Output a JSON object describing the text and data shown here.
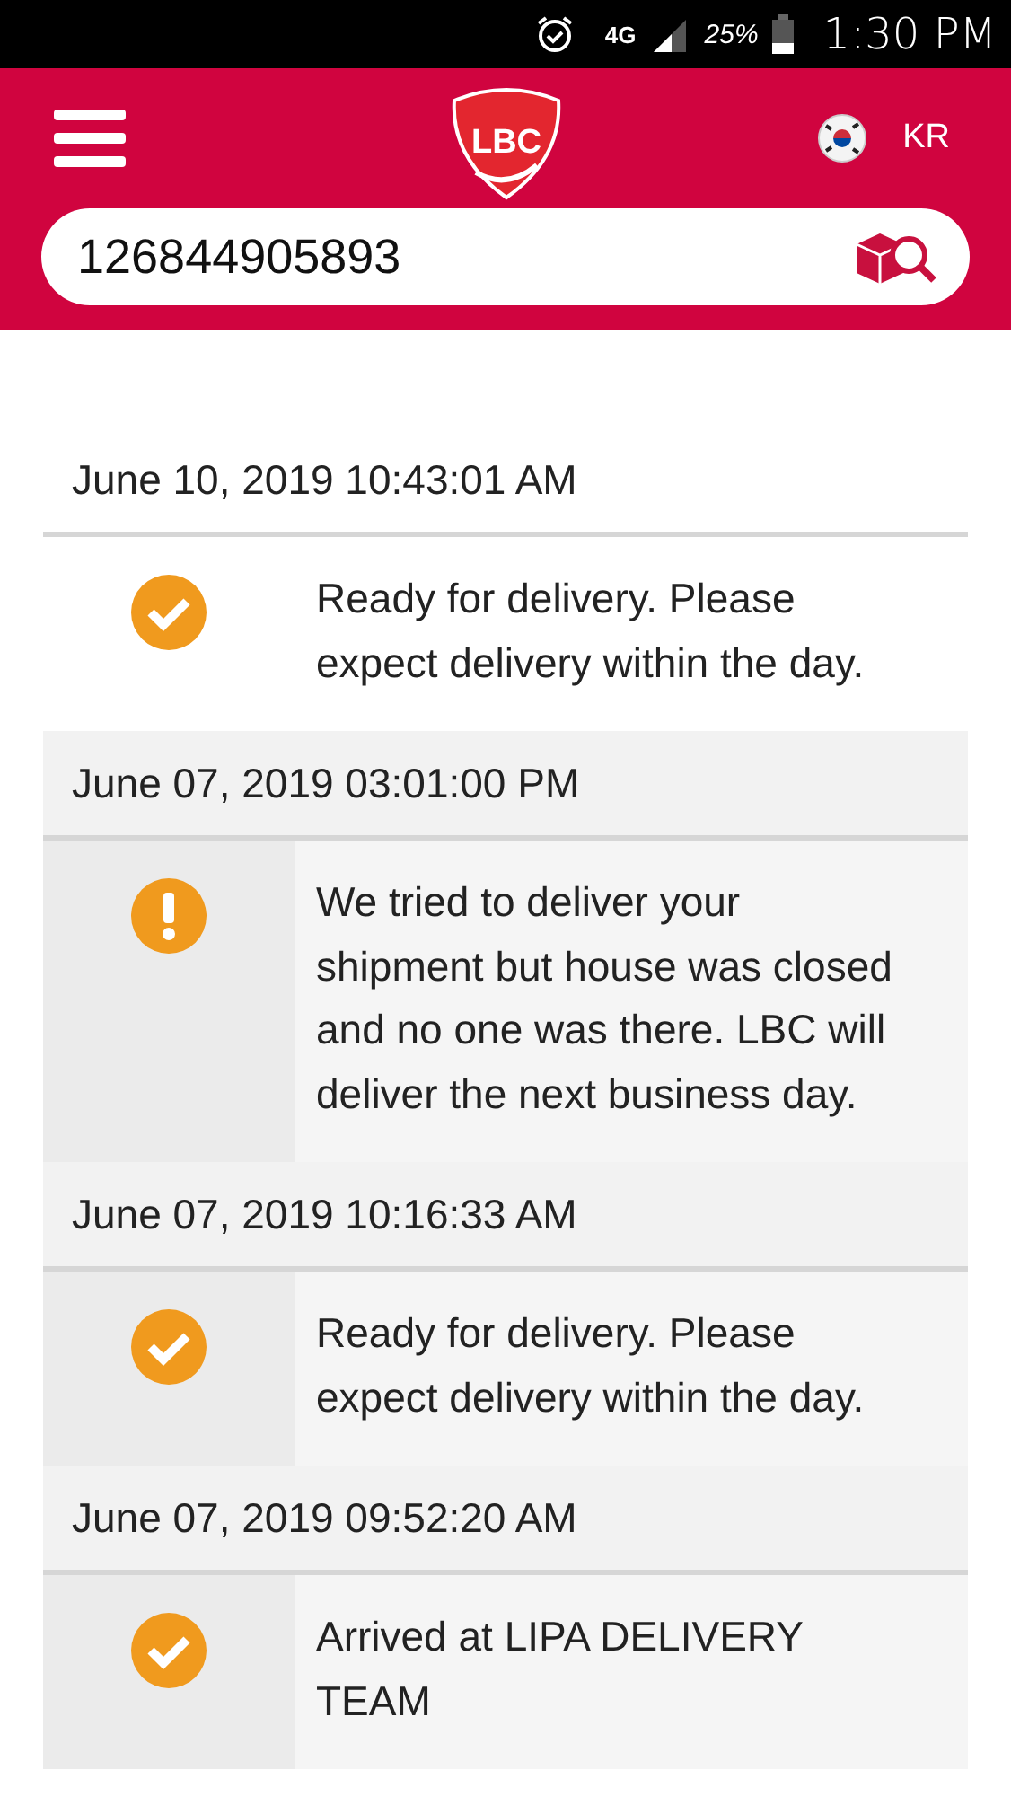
{
  "status_bar": {
    "network": "4G",
    "battery": "25%",
    "time": "1:30 PM"
  },
  "header": {
    "logo": "LBC",
    "language": "KR"
  },
  "search": {
    "value": "126844905893"
  },
  "events": [
    {
      "date": "June 10, 2019 10:43:01 AM",
      "kind": "done",
      "selected": true,
      "message": "Ready for delivery. Please expect delivery within the day."
    },
    {
      "date": "June 07, 2019 03:01:00 PM",
      "kind": "warning",
      "selected": false,
      "message": "We tried to deliver your shipment but house was closed and no one was there. LBC will deliver the next business day."
    },
    {
      "date": "June 07, 2019 10:16:33 AM",
      "kind": "done",
      "selected": false,
      "message": "Ready for delivery. Please expect delivery within the day."
    },
    {
      "date": "June 07, 2019 09:52:20 AM",
      "kind": "done",
      "selected": false,
      "message": "Arrived at LIPA DELIVERY TEAM"
    }
  ]
}
